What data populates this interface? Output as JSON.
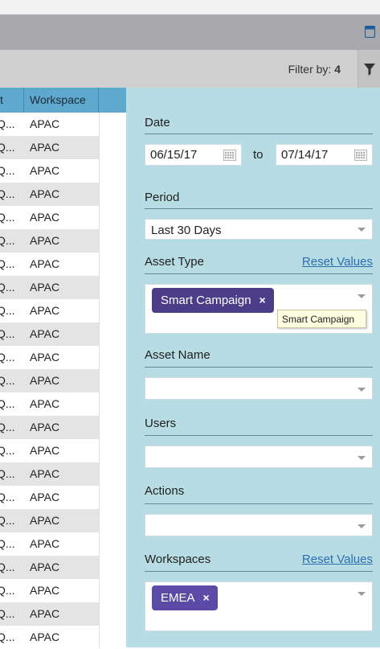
{
  "toolbar": {
    "filter_by_label": "Filter by:",
    "filter_count": "4"
  },
  "grid": {
    "columns": [
      "t",
      "Workspace"
    ],
    "rows": [
      {
        "c1": "Q...",
        "c2": "APAC"
      },
      {
        "c1": "Q...",
        "c2": "APAC"
      },
      {
        "c1": "Q...",
        "c2": "APAC"
      },
      {
        "c1": "Q...",
        "c2": "APAC"
      },
      {
        "c1": "Q...",
        "c2": "APAC"
      },
      {
        "c1": "Q...",
        "c2": "APAC"
      },
      {
        "c1": "Q...",
        "c2": "APAC"
      },
      {
        "c1": "Q...",
        "c2": "APAC"
      },
      {
        "c1": "Q...",
        "c2": "APAC"
      },
      {
        "c1": "Q...",
        "c2": "APAC"
      },
      {
        "c1": "Q...",
        "c2": "APAC"
      },
      {
        "c1": "Q...",
        "c2": "APAC"
      },
      {
        "c1": "Q...",
        "c2": "APAC"
      },
      {
        "c1": "Q...",
        "c2": "APAC"
      },
      {
        "c1": "Q...",
        "c2": "APAC"
      },
      {
        "c1": "Q...",
        "c2": "APAC"
      },
      {
        "c1": "Q...",
        "c2": "APAC"
      },
      {
        "c1": "Q...",
        "c2": "APAC"
      },
      {
        "c1": "Q...",
        "c2": "APAC"
      },
      {
        "c1": "Q...",
        "c2": "APAC"
      },
      {
        "c1": "Q...",
        "c2": "APAC"
      },
      {
        "c1": "Q...",
        "c2": "APAC"
      },
      {
        "c1": "Q...",
        "c2": "APAC"
      }
    ]
  },
  "filters": {
    "date": {
      "label": "Date",
      "from": "06/15/17",
      "to_label": "to",
      "to": "07/14/17"
    },
    "period": {
      "label": "Period",
      "value": "Last 30 Days"
    },
    "asset_type": {
      "label": "Asset Type",
      "reset_label": "Reset Values",
      "tag": "Smart Campaign",
      "tag_remove": "×",
      "tooltip": "Smart Campaign"
    },
    "asset_name": {
      "label": "Asset Name",
      "value": ""
    },
    "users": {
      "label": "Users",
      "value": ""
    },
    "actions": {
      "label": "Actions",
      "value": ""
    },
    "workspaces": {
      "label": "Workspaces",
      "reset_label": "Reset Values",
      "tag": "EMEA",
      "tag_remove": "×"
    }
  },
  "colors": {
    "panel_bg": "#b7dce4",
    "grid_header": "#5fa9cf",
    "tag_purple": "#4c3d89",
    "link_blue": "#2b6fb0"
  }
}
